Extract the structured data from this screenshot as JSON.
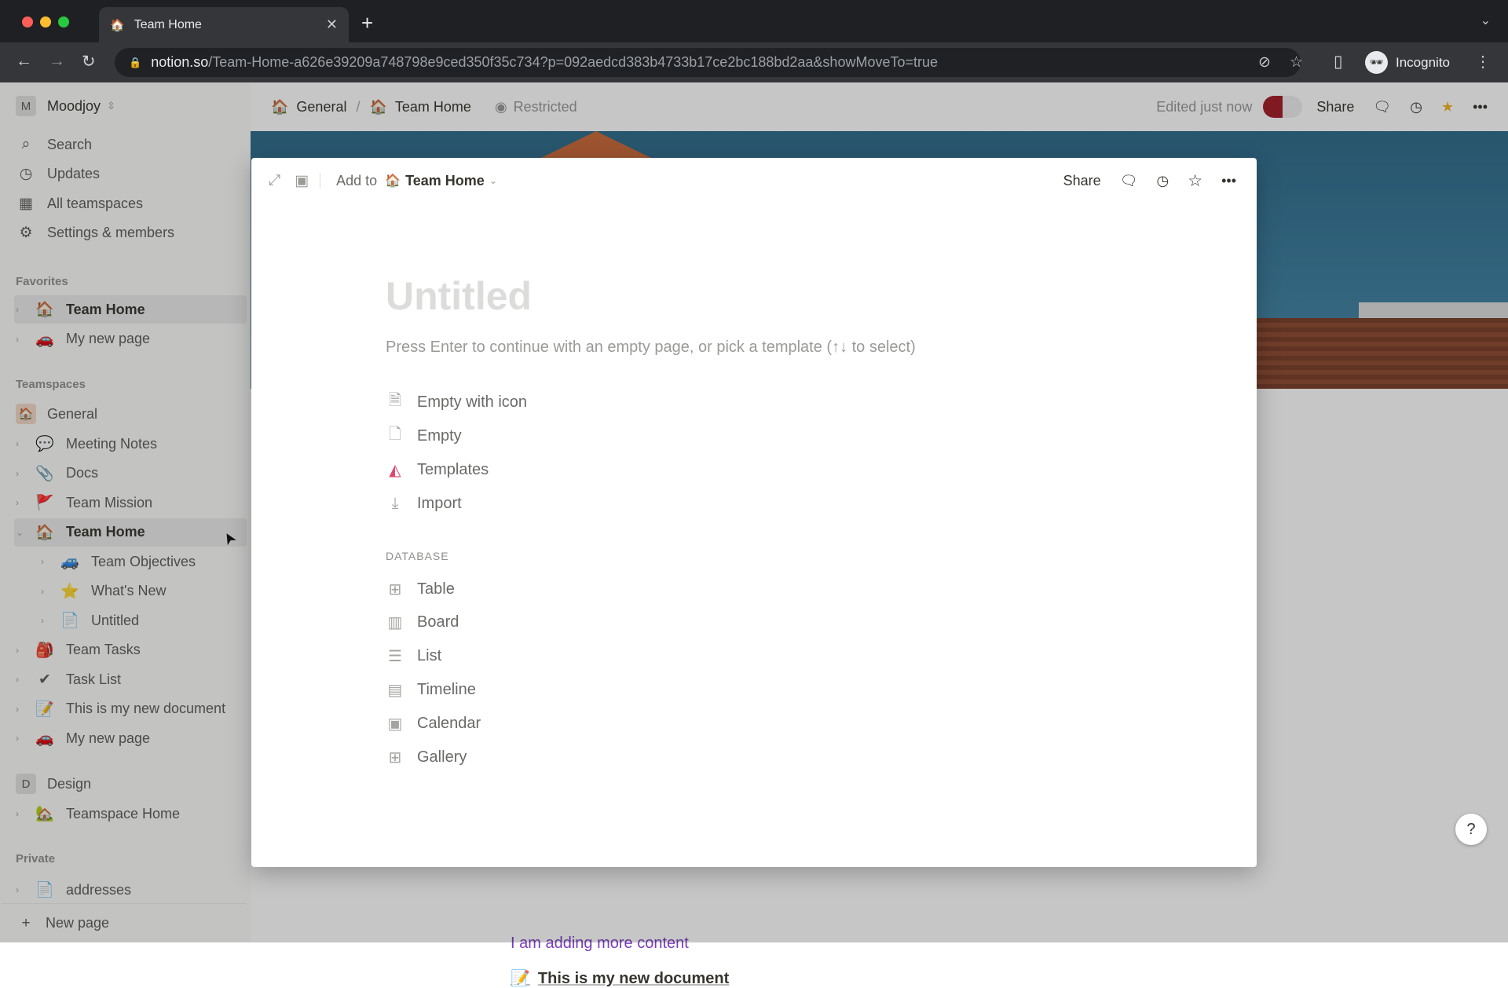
{
  "browser": {
    "tab_title": "Team Home",
    "url_host": "notion.so",
    "url_path": "/Team-Home-a626e39209a748798e9ced350f35c734?p=092aedcd383b4733b17ce2bc188bd2aa&showMoveTo=true",
    "profile": "Incognito"
  },
  "sidebar": {
    "workspace": "Moodjoy",
    "workspace_initial": "M",
    "nav": [
      {
        "label": "Search",
        "icon": "search-icon",
        "g": "⌕"
      },
      {
        "label": "Updates",
        "icon": "clock-icon",
        "g": "◷"
      },
      {
        "label": "All teamspaces",
        "icon": "building-icon",
        "g": "▦"
      },
      {
        "label": "Settings & members",
        "icon": "gear-icon",
        "g": "⚙"
      }
    ],
    "favorites_label": "Favorites",
    "favorites": [
      {
        "label": "Team Home",
        "g": "🏠",
        "selected": true
      },
      {
        "label": "My new page",
        "g": "🚗"
      }
    ],
    "teamspaces_label": "Teamspaces",
    "general": "General",
    "general_items": [
      {
        "label": "Meeting Notes",
        "g": "💬",
        "level": 0
      },
      {
        "label": "Docs",
        "g": "📎",
        "level": 0
      },
      {
        "label": "Team Mission",
        "g": "🚩",
        "level": 0
      },
      {
        "label": "Team Home",
        "g": "🏠",
        "level": 0,
        "open": true,
        "bold": true
      },
      {
        "label": "Team Objectives",
        "g": "🚙",
        "level": 1
      },
      {
        "label": "What's New",
        "g": "⭐",
        "level": 1
      },
      {
        "label": "Untitled",
        "g": "📄",
        "level": 1
      },
      {
        "label": "Team Tasks",
        "g": "🎒",
        "level": 0
      },
      {
        "label": "Task List",
        "g": "✔",
        "level": 0
      },
      {
        "label": "This is my new document",
        "g": "📝",
        "level": 0
      },
      {
        "label": "My new page",
        "g": "🚗",
        "level": 0
      }
    ],
    "design": "Design",
    "design_initial": "D",
    "design_items": [
      {
        "label": "Teamspace Home",
        "g": "🏡"
      }
    ],
    "private_label": "Private",
    "private_items": [
      {
        "label": "addresses",
        "g": "📄"
      }
    ],
    "new_page": "New page"
  },
  "topbar": {
    "crumb1": "General",
    "crumb2": "Team Home",
    "restricted": "Restricted",
    "edited": "Edited just now",
    "share": "Share"
  },
  "page": {
    "link_text": "I am adding more content",
    "doc_link": "This is my new document",
    "help": "?"
  },
  "modal": {
    "add_to": "Add to",
    "target": "Team Home",
    "share": "Share",
    "title_placeholder": "Untitled",
    "hint": "Press Enter to continue with an empty page, or pick a template (↑↓ to select)",
    "options": [
      {
        "label": "Empty with icon",
        "icon": "page-text-icon",
        "g": "🗎"
      },
      {
        "label": "Empty",
        "icon": "page-icon",
        "g": "🗋"
      },
      {
        "label": "Templates",
        "icon": "templates-icon",
        "g": "◭"
      },
      {
        "label": "Import",
        "icon": "download-icon",
        "g": "⤓"
      }
    ],
    "database_label": "DATABASE",
    "database": [
      {
        "label": "Table",
        "icon": "table-icon",
        "g": "⊞"
      },
      {
        "label": "Board",
        "icon": "board-icon",
        "g": "▥"
      },
      {
        "label": "List",
        "icon": "list-icon",
        "g": "☰"
      },
      {
        "label": "Timeline",
        "icon": "timeline-icon",
        "g": "▤"
      },
      {
        "label": "Calendar",
        "icon": "calendar-icon",
        "g": "▣"
      },
      {
        "label": "Gallery",
        "icon": "gallery-icon",
        "g": "⊞"
      }
    ]
  },
  "colors": {
    "accent_purple": "#7a3ec0",
    "star": "#f0b429"
  }
}
